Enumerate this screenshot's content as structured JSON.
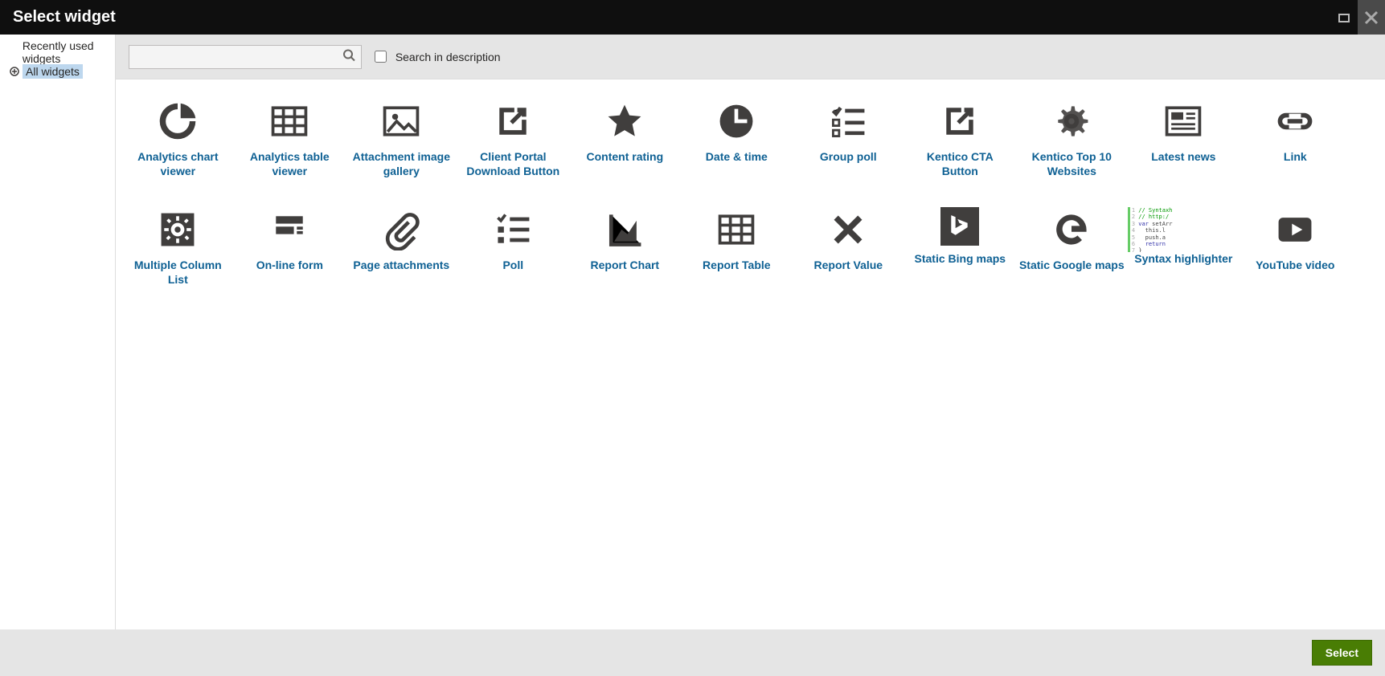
{
  "header": {
    "title": "Select widget"
  },
  "sidebar": {
    "items": [
      {
        "label": "Recently used widgets",
        "selected": false
      },
      {
        "label": "All widgets",
        "selected": true
      }
    ]
  },
  "toolbar": {
    "search_value": "",
    "search_checkbox_label": "Search in description"
  },
  "widgets": [
    {
      "label": "Analytics chart viewer",
      "icon": "pie-chart-icon"
    },
    {
      "label": "Analytics table viewer",
      "icon": "table-icon"
    },
    {
      "label": "Attachment image gallery",
      "icon": "image-icon"
    },
    {
      "label": "Client Portal Download Button",
      "icon": "external-link-icon"
    },
    {
      "label": "Content rating",
      "icon": "star-icon"
    },
    {
      "label": "Date & time",
      "icon": "clock-icon"
    },
    {
      "label": "Group poll",
      "icon": "checklist-icon"
    },
    {
      "label": "Kentico CTA Button",
      "icon": "external-link-icon"
    },
    {
      "label": "Kentico Top 10 Websites",
      "icon": "gear-icon"
    },
    {
      "label": "Latest news",
      "icon": "newspaper-icon"
    },
    {
      "label": "Link",
      "icon": "link-icon"
    },
    {
      "label": "Multiple Column List",
      "icon": "gear-box-icon"
    },
    {
      "label": "On-line form",
      "icon": "form-icon"
    },
    {
      "label": "Page attachments",
      "icon": "paperclip-icon"
    },
    {
      "label": "Poll",
      "icon": "checklist-alt-icon"
    },
    {
      "label": "Report Chart",
      "icon": "area-chart-icon"
    },
    {
      "label": "Report Table",
      "icon": "table-icon"
    },
    {
      "label": "Report Value",
      "icon": "x-icon"
    },
    {
      "label": "Static Bing maps",
      "icon": "bing-icon"
    },
    {
      "label": "Static Google maps",
      "icon": "google-icon"
    },
    {
      "label": "Syntax highlighter",
      "icon": "syntax-icon"
    },
    {
      "label": "YouTube video",
      "icon": "youtube-icon"
    }
  ],
  "footer": {
    "select_label": "Select"
  }
}
